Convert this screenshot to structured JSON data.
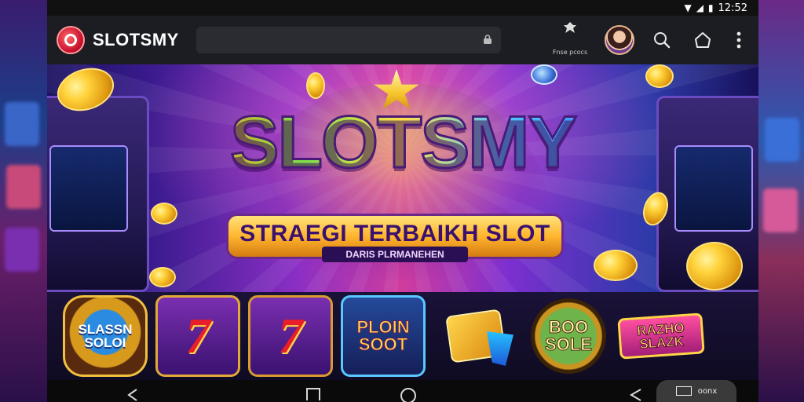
{
  "status_bar": {
    "time": "12:52"
  },
  "app": {
    "name": "SLOTSMY"
  },
  "search": {
    "value": "",
    "placeholder": ""
  },
  "extension": {
    "label": "Fnse pcocs"
  },
  "banner": {
    "title": "SLOTSMY",
    "subtitle": "STRAEGI TERBAIKH SLOT",
    "tagline": "DARIS PLRMANEHEN"
  },
  "games": [
    {
      "label": "SLASSN\nSOLOI",
      "icon": "coin-badge"
    },
    {
      "label": "",
      "icon": "seven-symbol"
    },
    {
      "label": "",
      "icon": "seven-symbol"
    },
    {
      "label": "PLOIN\nSOOT",
      "icon": "plain-badge"
    },
    {
      "label": "",
      "icon": "cube-cone"
    },
    {
      "label": "BOO\nSOLE",
      "icon": "round-medal"
    },
    {
      "label": "RAZHO\nSLAZK",
      "icon": "pink-plate"
    }
  ],
  "nav_pill": {
    "label": "oonx"
  },
  "colors": {
    "appbar": "#1b1d22",
    "brand_red": "#c8102e",
    "gold": "#ffd23a"
  }
}
